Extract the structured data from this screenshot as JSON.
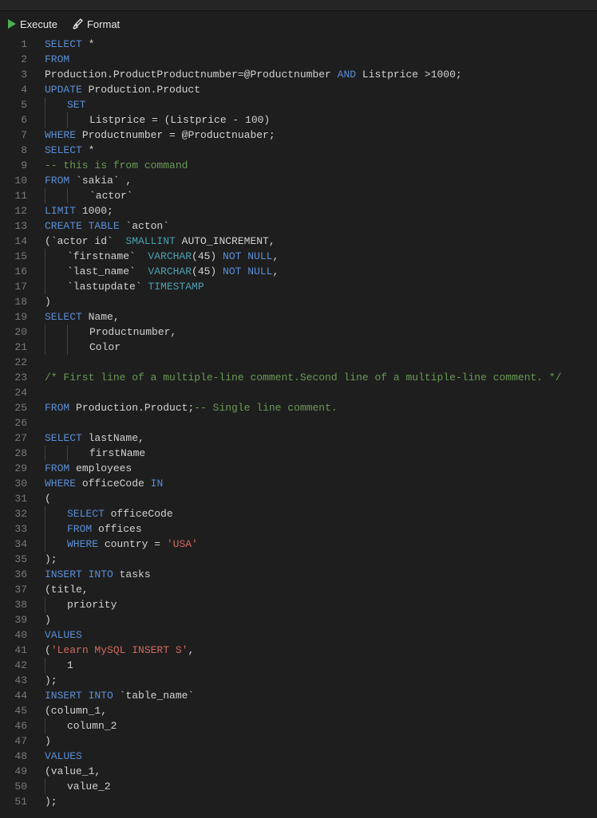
{
  "toolbar": {
    "execute_label": "Execute",
    "format_label": "Format"
  },
  "code_lines": [
    {
      "n": 1,
      "indent": 0,
      "spans": [
        {
          "c": "kw",
          "t": "SELECT"
        },
        {
          "c": "op",
          "t": " *"
        }
      ]
    },
    {
      "n": 2,
      "indent": 0,
      "spans": [
        {
          "c": "kw",
          "t": "FROM"
        }
      ]
    },
    {
      "n": 3,
      "indent": 0,
      "spans": [
        {
          "c": "ident",
          "t": "Production.ProductProductnumber=@Productnumber "
        },
        {
          "c": "kw",
          "t": "AND"
        },
        {
          "c": "ident",
          "t": " Listprice >1000;"
        }
      ]
    },
    {
      "n": 4,
      "indent": 0,
      "spans": [
        {
          "c": "kw",
          "t": "UPDATE"
        },
        {
          "c": "ident",
          "t": " Production.Product"
        }
      ]
    },
    {
      "n": 5,
      "indent": 1,
      "spans": [
        {
          "c": "kw",
          "t": "SET"
        }
      ]
    },
    {
      "n": 6,
      "indent": 2,
      "spans": [
        {
          "c": "ident",
          "t": "Listprice = (Listprice - 100)"
        }
      ]
    },
    {
      "n": 7,
      "indent": 0,
      "spans": [
        {
          "c": "kw",
          "t": "WHERE"
        },
        {
          "c": "ident",
          "t": " Productnumber = @Productnuaber;"
        }
      ]
    },
    {
      "n": 8,
      "indent": 0,
      "spans": [
        {
          "c": "kw",
          "t": "SELECT"
        },
        {
          "c": "op",
          "t": " *"
        }
      ]
    },
    {
      "n": 9,
      "indent": 0,
      "spans": [
        {
          "c": "cmt",
          "t": "-- this is from command"
        }
      ]
    },
    {
      "n": 10,
      "indent": 0,
      "spans": [
        {
          "c": "kw",
          "t": "FROM"
        },
        {
          "c": "ident",
          "t": " `sakia` ,"
        }
      ]
    },
    {
      "n": 11,
      "indent": 2,
      "spans": [
        {
          "c": "ident",
          "t": "`actor`"
        }
      ]
    },
    {
      "n": 12,
      "indent": 0,
      "spans": [
        {
          "c": "kw",
          "t": "LIMIT"
        },
        {
          "c": "ident",
          "t": " 1000;"
        }
      ]
    },
    {
      "n": 13,
      "indent": 0,
      "spans": [
        {
          "c": "kw",
          "t": "CREATE TABLE"
        },
        {
          "c": "ident",
          "t": " `acton`"
        }
      ]
    },
    {
      "n": 14,
      "indent": 0,
      "spans": [
        {
          "c": "ident",
          "t": "(`actor id`  "
        },
        {
          "c": "typ",
          "t": "SMALLINT"
        },
        {
          "c": "ident",
          "t": " AUTO_INCREMENT,"
        }
      ]
    },
    {
      "n": 15,
      "indent": 1,
      "spans": [
        {
          "c": "ident",
          "t": "`firstname`  "
        },
        {
          "c": "typ",
          "t": "VARCHAR"
        },
        {
          "c": "ident",
          "t": "(45) "
        },
        {
          "c": "kw",
          "t": "NOT NULL"
        },
        {
          "c": "ident",
          "t": ","
        }
      ]
    },
    {
      "n": 16,
      "indent": 1,
      "spans": [
        {
          "c": "ident",
          "t": "`last_name`  "
        },
        {
          "c": "typ",
          "t": "VARCHAR"
        },
        {
          "c": "ident",
          "t": "(45) "
        },
        {
          "c": "kw",
          "t": "NOT NULL"
        },
        {
          "c": "ident",
          "t": ","
        }
      ]
    },
    {
      "n": 17,
      "indent": 1,
      "spans": [
        {
          "c": "ident",
          "t": "`lastupdate` "
        },
        {
          "c": "typ",
          "t": "TIMESTAMP"
        }
      ]
    },
    {
      "n": 18,
      "indent": 0,
      "spans": [
        {
          "c": "ident",
          "t": ")"
        }
      ]
    },
    {
      "n": 19,
      "indent": 0,
      "spans": [
        {
          "c": "kw",
          "t": "SELECT"
        },
        {
          "c": "ident",
          "t": " Name,"
        }
      ]
    },
    {
      "n": 20,
      "indent": 2,
      "spans": [
        {
          "c": "ident",
          "t": "Productnumber,"
        }
      ]
    },
    {
      "n": 21,
      "indent": 2,
      "spans": [
        {
          "c": "ident",
          "t": "Color"
        }
      ]
    },
    {
      "n": 22,
      "indent": 0,
      "spans": []
    },
    {
      "n": 23,
      "indent": 0,
      "spans": [
        {
          "c": "cmt",
          "t": "/* First line of a multiple-line comment.Second line of a multiple-line comment. */"
        }
      ]
    },
    {
      "n": 24,
      "indent": 0,
      "spans": []
    },
    {
      "n": 25,
      "indent": 0,
      "spans": [
        {
          "c": "kw",
          "t": "FROM"
        },
        {
          "c": "ident",
          "t": " Production.Product;"
        },
        {
          "c": "cmt",
          "t": "-- Single line comment."
        }
      ]
    },
    {
      "n": 26,
      "indent": 0,
      "spans": []
    },
    {
      "n": 27,
      "indent": 0,
      "spans": [
        {
          "c": "kw",
          "t": "SELECT"
        },
        {
          "c": "ident",
          "t": " lastName,"
        }
      ]
    },
    {
      "n": 28,
      "indent": 2,
      "spans": [
        {
          "c": "ident",
          "t": "firstName"
        }
      ]
    },
    {
      "n": 29,
      "indent": 0,
      "spans": [
        {
          "c": "kw",
          "t": "FROM"
        },
        {
          "c": "ident",
          "t": " employees"
        }
      ]
    },
    {
      "n": 30,
      "indent": 0,
      "spans": [
        {
          "c": "kw",
          "t": "WHERE"
        },
        {
          "c": "ident",
          "t": " officeCode "
        },
        {
          "c": "kw",
          "t": "IN"
        }
      ]
    },
    {
      "n": 31,
      "indent": 0,
      "spans": [
        {
          "c": "ident",
          "t": "("
        }
      ]
    },
    {
      "n": 32,
      "indent": 1,
      "spans": [
        {
          "c": "kw",
          "t": "SELECT"
        },
        {
          "c": "ident",
          "t": " officeCode"
        }
      ]
    },
    {
      "n": 33,
      "indent": 1,
      "spans": [
        {
          "c": "kw",
          "t": "FROM"
        },
        {
          "c": "ident",
          "t": " offices"
        }
      ]
    },
    {
      "n": 34,
      "indent": 1,
      "spans": [
        {
          "c": "kw",
          "t": "WHERE"
        },
        {
          "c": "ident",
          "t": " country = "
        },
        {
          "c": "str",
          "t": "'USA'"
        }
      ]
    },
    {
      "n": 35,
      "indent": 0,
      "spans": [
        {
          "c": "ident",
          "t": ");"
        }
      ]
    },
    {
      "n": 36,
      "indent": 0,
      "spans": [
        {
          "c": "kw",
          "t": "INSERT INTO"
        },
        {
          "c": "ident",
          "t": " tasks"
        }
      ]
    },
    {
      "n": 37,
      "indent": 0,
      "spans": [
        {
          "c": "ident",
          "t": "(title,"
        }
      ]
    },
    {
      "n": 38,
      "indent": 1,
      "spans": [
        {
          "c": "ident",
          "t": "priority"
        }
      ]
    },
    {
      "n": 39,
      "indent": 0,
      "spans": [
        {
          "c": "ident",
          "t": ")"
        }
      ]
    },
    {
      "n": 40,
      "indent": 0,
      "spans": [
        {
          "c": "kw",
          "t": "VALUES"
        }
      ]
    },
    {
      "n": 41,
      "indent": 0,
      "spans": [
        {
          "c": "ident",
          "t": "("
        },
        {
          "c": "str",
          "t": "'Learn MySQL INSERT S'"
        },
        {
          "c": "ident",
          "t": ","
        }
      ]
    },
    {
      "n": 42,
      "indent": 1,
      "spans": [
        {
          "c": "ident",
          "t": "1"
        }
      ]
    },
    {
      "n": 43,
      "indent": 0,
      "spans": [
        {
          "c": "ident",
          "t": ");"
        }
      ]
    },
    {
      "n": 44,
      "indent": 0,
      "spans": [
        {
          "c": "kw",
          "t": "INSERT INTO"
        },
        {
          "c": "ident",
          "t": " `table_name`"
        }
      ]
    },
    {
      "n": 45,
      "indent": 0,
      "spans": [
        {
          "c": "ident",
          "t": "(column_1,"
        }
      ]
    },
    {
      "n": 46,
      "indent": 1,
      "spans": [
        {
          "c": "ident",
          "t": "column_2"
        }
      ]
    },
    {
      "n": 47,
      "indent": 0,
      "spans": [
        {
          "c": "ident",
          "t": ")"
        }
      ]
    },
    {
      "n": 48,
      "indent": 0,
      "spans": [
        {
          "c": "kw",
          "t": "VALUES"
        }
      ]
    },
    {
      "n": 49,
      "indent": 0,
      "spans": [
        {
          "c": "ident",
          "t": "(value_1,"
        }
      ]
    },
    {
      "n": 50,
      "indent": 1,
      "spans": [
        {
          "c": "ident",
          "t": "value_2"
        }
      ]
    },
    {
      "n": 51,
      "indent": 0,
      "spans": [
        {
          "c": "ident",
          "t": ");"
        }
      ]
    }
  ]
}
